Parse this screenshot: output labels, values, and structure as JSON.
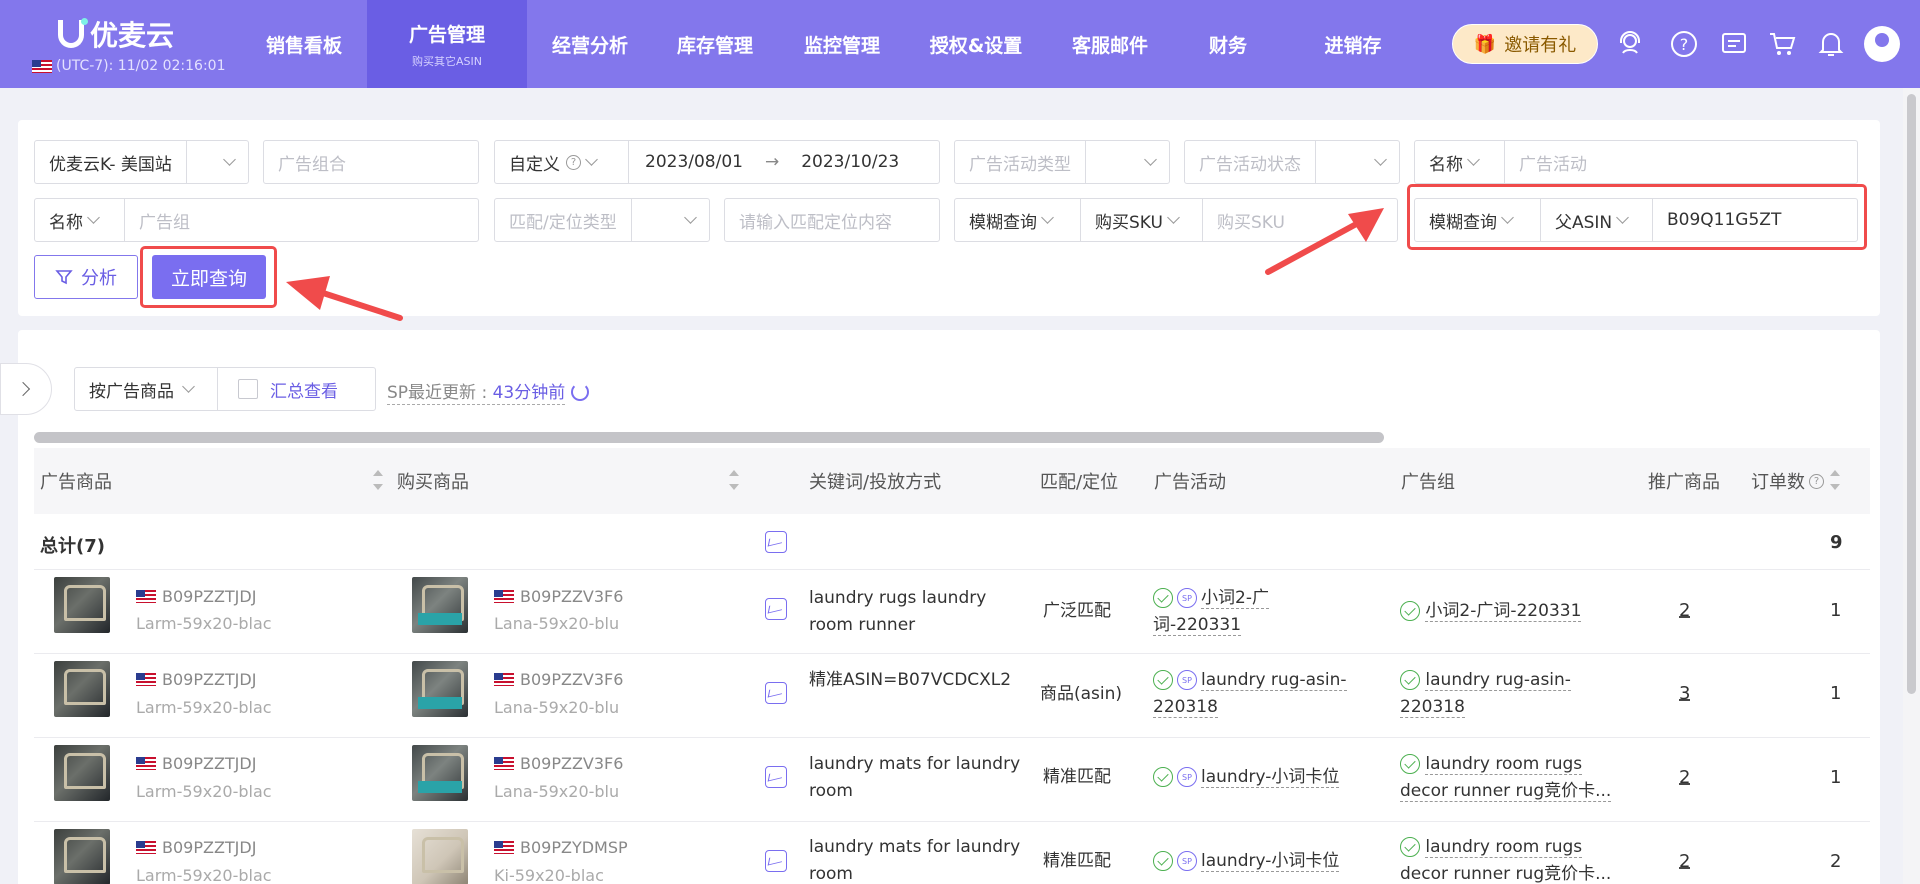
{
  "header": {
    "brand": "优麦云",
    "timezone": "(UTC-7): 11/02 02:16:01",
    "menu": [
      "销售看板",
      "广告管理",
      "经营分析",
      "库存管理",
      "监控管理",
      "授权&设置",
      "客服邮件",
      "财务",
      "进销存"
    ],
    "active_sub": "购买其它ASIN",
    "invite": "邀请有礼",
    "icons": [
      "support-icon",
      "help-icon",
      "message-icon",
      "cart-icon",
      "bell-icon",
      "avatar"
    ]
  },
  "filters": {
    "store": "优麦云K- 美国站",
    "ad_portfolio_ph": "广告组合",
    "date_mode": "自定义",
    "date_start": "2023/08/01",
    "date_end": "2023/10/23",
    "campaign_type_ph": "广告活动类型",
    "campaign_status_ph": "广告活动状态",
    "name_label": "名称",
    "campaign_ph": "广告活动",
    "name2_label": "名称",
    "adgroup_ph": "广告组",
    "match_type_ph": "匹配/定位类型",
    "match_content_ph": "请输入匹配定位内容",
    "fuzzy1": "模糊查询",
    "sku_label": "购买SKU",
    "sku_ph": "购买SKU",
    "fuzzy2": "模糊查询",
    "parent_asin_label": "父ASIN",
    "parent_asin_value": "B09Q11G5ZT",
    "analyze": "分析",
    "query": "立即查询"
  },
  "toolbar": {
    "by_ad": "按广告商品",
    "summary": "汇总查看",
    "update_label": "SP最近更新 :",
    "update_value": "43分钟前"
  },
  "table": {
    "headers": [
      "广告商品",
      "购买商品",
      "关键词/投放方式",
      "匹配/定位",
      "广告活动",
      "广告组",
      "推广商品",
      "订单数"
    ],
    "total_label": "总计(7)",
    "total_orders": "9",
    "rows": [
      {
        "ad_asin": "B09PZZTJDJ",
        "ad_sku": "Larm-59x20-blac",
        "buy_asin": "B09PZZV3F6",
        "buy_sku": "Lana-59x20-blu",
        "keyword1": "laundry rugs laundry",
        "keyword2": "room runner",
        "match": "广泛匹配",
        "campaign1": "小词2-广",
        "campaign2": "词-220331",
        "adgroup1": "小词2-广词-220331",
        "adgroup2": "",
        "promoted": "2",
        "orders": "1"
      },
      {
        "ad_asin": "B09PZZTJDJ",
        "ad_sku": "Larm-59x20-blac",
        "buy_asin": "B09PZZV3F6",
        "buy_sku": "Lana-59x20-blu",
        "keyword1": "精准ASIN=B07VCDCXL2",
        "keyword2": "",
        "match": "商品(asin)",
        "campaign1": "laundry rug-asin-",
        "campaign2": "220318",
        "adgroup1": "laundry rug-asin-",
        "adgroup2": "220318",
        "promoted": "3",
        "orders": "1"
      },
      {
        "ad_asin": "B09PZZTJDJ",
        "ad_sku": "Larm-59x20-blac",
        "buy_asin": "B09PZZV3F6",
        "buy_sku": "Lana-59x20-blu",
        "keyword1": "laundry mats for laundry",
        "keyword2": "room",
        "match": "精准匹配",
        "campaign1": "laundry-小词卡位",
        "campaign2": "",
        "adgroup1": "laundry room rugs",
        "adgroup2": "decor runner rug竞价卡...",
        "promoted": "2",
        "orders": "1"
      },
      {
        "ad_asin": "B09PZZTJDJ",
        "ad_sku": "Larm-59x20-blac",
        "buy_asin": "B09PZYDMSP",
        "buy_sku": "Ki-59x20-blac",
        "keyword1": "laundry mats for laundry",
        "keyword2": "room",
        "match": "精准匹配",
        "campaign1": "laundry-小词卡位",
        "campaign2": "",
        "adgroup1": "laundry room rugs",
        "adgroup2": "decor runner rug竞价卡...",
        "promoted": "2",
        "orders": "2"
      }
    ]
  }
}
